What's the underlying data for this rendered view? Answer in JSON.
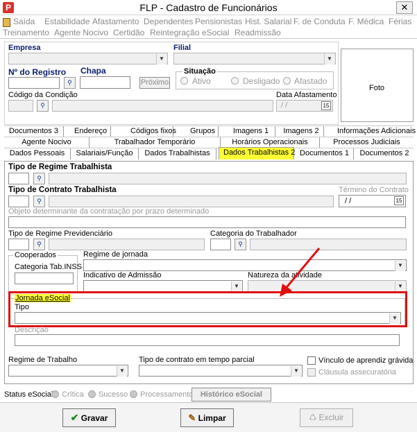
{
  "window": {
    "title": "FLP - Cadastro de Funcionários",
    "close": "✕",
    "app_icon": "P"
  },
  "menu": [
    {
      "label": "Saída",
      "on": true
    },
    {
      "label": "Estabilidade",
      "on": false
    },
    {
      "label": "Afastamento",
      "on": false
    },
    {
      "label": "Dependentes",
      "on": false
    },
    {
      "label": "Pensionistas",
      "on": false
    },
    {
      "label": "Hist. Salarial",
      "on": false
    },
    {
      "label": "F. de Conduta",
      "on": false
    },
    {
      "label": "F. Médica",
      "on": false
    },
    {
      "label": "Férias",
      "on": false
    },
    {
      "label": "Treinamento",
      "on": false
    },
    {
      "label": "Agente Nocivo",
      "on": false
    },
    {
      "label": "Certidão",
      "on": true
    },
    {
      "label": "Reintegração",
      "on": false
    },
    {
      "label": "eSocial",
      "on": false
    },
    {
      "label": "Readmissão",
      "on": true
    }
  ],
  "form": {
    "empresa_label": "Empresa",
    "filial_label": "Filial",
    "registro_label": "Nº do Registro",
    "chapa_label": "Chapa",
    "proximo_btn": "Próximo",
    "situacao_label": "Situação",
    "situacoes": [
      "Ativo",
      "Desligado",
      "Afastado"
    ],
    "foto": "Foto",
    "codigo_condicao_label": "Código da Condição",
    "data_afastamento_label": "Data Afastamento",
    "date_placeholder": "/ /"
  },
  "tabs": {
    "row1": [
      "Documentos 3",
      "Endereço",
      "Códigos fixos",
      "Grupos",
      "Imagens 1",
      "Imagens 2",
      "Informações Adicionais"
    ],
    "row2": [
      "Agente Nocivo",
      "Trabalhador Temporário",
      "Horários Operacionais",
      "Processos Judiciais"
    ],
    "row3": [
      "Dados Pessoais",
      "Salariais/Função",
      "Dados Trabalhistas",
      "Dados Trabalhistas 2",
      "Documentos 1",
      "Documentos 2"
    ]
  },
  "panel": {
    "tipo_regime_label": "Tipo de Regime Trabalhista",
    "tipo_contrato_label": "Tipo de Contrato Trabalhista",
    "termino_contrato_label": "Término do Contrato",
    "objeto_label": "Objeto determinante da contratação por prazo determinado",
    "regime_prev_label": "Tipo de Regime Previdenciário",
    "categoria_trab_label": "Categoria do Trabalhador",
    "cooperados_label": "Cooperados",
    "categoria_inss_label": "Categoria Tab.INSS",
    "regime_jornada_label": "Regime de jornada",
    "indicativo_label": "Indicativo de Admissão",
    "natureza_label": "Natureza da atividade",
    "jornada_label": "Jornada eSocial",
    "tipo_label": "Tipo",
    "descricao_label": "Descrição",
    "regime_trabalho_label": "Regime de Trabalho",
    "tipo_contrato_parcial_label": "Tipo de contrato em tempo parcial",
    "vinculo_label": "Vínculo de aprendiz grávida",
    "clausula_label": "Cláusula assecuratória"
  },
  "status": {
    "label": "Status eSocial",
    "options": [
      "Crítica",
      "Sucesso",
      "Processamento"
    ],
    "historico": "Histórico eSocial"
  },
  "footer": {
    "gravar": "Gravar",
    "limpar": "Limpar",
    "excluir": "Excluir"
  },
  "colors": {
    "highlight": "#ffff33",
    "annotation": "#e01010"
  }
}
